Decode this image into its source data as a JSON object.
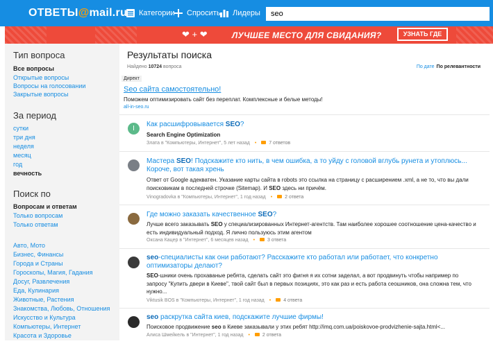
{
  "header": {
    "logo_main": "ОТВЕТЫ",
    "logo_at": "@",
    "logo_domain": "mail.ru",
    "nav": [
      {
        "label": "Категории",
        "icon": "categories-icon"
      },
      {
        "label": "Спросить",
        "icon": "plus-icon"
      },
      {
        "label": "Лидеры",
        "icon": "leaders-bars-icon"
      }
    ],
    "search_value": "seo",
    "accent_color": "#168de2"
  },
  "banner": {
    "hearts": "❤ + ❤",
    "text": "ЛУЧШЕЕ МЕСТО ДЛЯ СВИДАНИЯ?",
    "button": "УЗНАТЬ ГДЕ",
    "color": "#ee4a3a"
  },
  "sidebar": {
    "type_heading": "Тип вопроса",
    "type_items": [
      {
        "label": "Все вопросы",
        "active": true
      },
      {
        "label": "Открытые вопросы",
        "active": false
      },
      {
        "label": "Вопросы на голосовании",
        "active": false
      },
      {
        "label": "Закрытые вопросы",
        "active": false
      }
    ],
    "period_heading": "За период",
    "period_items": [
      {
        "label": "сутки",
        "active": false
      },
      {
        "label": "три дня",
        "active": false
      },
      {
        "label": "неделя",
        "active": false
      },
      {
        "label": "месяц",
        "active": false
      },
      {
        "label": "год",
        "active": false
      },
      {
        "label": "вечность",
        "active": true
      }
    ],
    "search_heading": "Поиск по",
    "search_items": [
      {
        "label": "Вопросам и ответам",
        "active": true
      },
      {
        "label": "Только вопросам",
        "active": false
      },
      {
        "label": "Только ответам",
        "active": false
      }
    ],
    "categories": [
      "Авто, Мото",
      "Бизнес, Финансы",
      "Города и Страны",
      "Гороскопы, Магия, Гадания",
      "Досуг, Развлечения",
      "Еда, Кулинария",
      "Животные, Растения",
      "Знакомства, Любовь, Отношения",
      "Искусство и Культура",
      "Компьютеры, Интернет",
      "Красота и Здоровье"
    ]
  },
  "main": {
    "title": "Результаты поиска",
    "found_prefix": "Найдено",
    "found_count": "10724",
    "found_suffix": "вопроса",
    "sort_by_date": "По дате",
    "sort_by_relevance": "По релевантности",
    "direct": {
      "label": "Директ",
      "title": "Seo сайта самостоятельно!",
      "text": "Поможем оптимизировать сайт без переплат. Комплексные и белые методы!",
      "url": "all-in-seo.ru"
    },
    "questions": [
      {
        "title_before": "Как расшифровывается ",
        "title_hl": "SEO",
        "title_after": "?",
        "desc_html": "Search Engine Optimization",
        "author": "Злата в \"Компьютеры, Интернет\", 5 лет назад",
        "answers": "7 ответов",
        "avatar_color": "#5cba8a",
        "avatar_letter": "I"
      },
      {
        "title_before": "Мастера ",
        "title_hl": "SEO",
        "title_after": "! Подскажите кто нить, в чем ошибка, а то уйду с головой вглубь рунета и утоплюсь... Короче, вот такая хрень",
        "desc_html": "Ответ от Google адекватен. Указание карты сайта в robots это ссылка на страницу с расширением .xml, а не то, что вы дали поисковикам в последней строчке (Sitemap). И SEO здесь ни причём.",
        "author": "Vinogradovka в \"Компьютеры, Интернет\", 1 год назад",
        "answers": "2 ответа",
        "avatar_color": "#7a7f86",
        "avatar_letter": ""
      },
      {
        "title_before": "Где можно заказать качественное ",
        "title_hl": "SEO",
        "title_after": "?",
        "desc_html": "Лучше всего заказывать SEO у специализированных Интернет-агентств. Там наиболее хорошее соотношение цена-качество и есть индивидуальный подход. Я лично пользуюсь этим агентом",
        "author": "Оксана Кацер в \"Интернет\", 6 месяцев назад",
        "answers": "3 ответа",
        "avatar_color": "#8a6a3f",
        "avatar_letter": ""
      },
      {
        "title_before": "",
        "title_hl": "seo",
        "title_after": "-специалисты как они работают? Расскажите кто работал или работает, что конкретно оптимизаторы делают?",
        "desc_html": "SEO-шники очень прохаваные ребята, сделать сайт это фигня я их сотни заделал, а вот продвинуть чтобы например по запросу \"Купить двери в Киеве\", твой сайт был в первых позициях, это как раз и есть работа сеошников, она сложна тем, что нужно...",
        "author": "Viktusik BOS в \"Компьютеры, Интернет\", 1 год назад",
        "answers": "4 ответа",
        "avatar_color": "#3a3a3a",
        "avatar_letter": ""
      },
      {
        "title_before": "",
        "title_hl": "seo",
        "title_after": " раскрутка сайта киев, подскажите лучшие фирмы!",
        "desc_html": "Поисковое продвижение seo в Киеве заказывали у этих ребят http://imq.com.ua/poiskovoe-prodvizhenie-sajta.html<...",
        "author": "Алиса Шмейкель в \"Интернет\", 1 год назад",
        "answers": "2 ответа",
        "avatar_color": "#2a2a2a",
        "avatar_letter": ""
      }
    ]
  }
}
